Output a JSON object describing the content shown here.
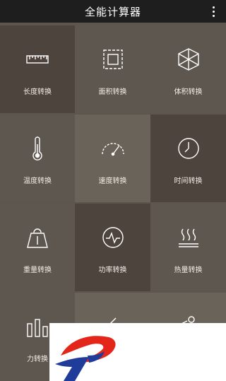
{
  "app": {
    "title": "全能计算器"
  },
  "header": {
    "menu_icon": "more-vert-icon"
  },
  "tiles": [
    {
      "label": "长度转换",
      "icon": "ruler-icon"
    },
    {
      "label": "面积转换",
      "icon": "area-square-icon"
    },
    {
      "label": "体积转换",
      "icon": "cube-icon"
    },
    {
      "label": "温度转换",
      "icon": "thermometer-icon"
    },
    {
      "label": "速度转换",
      "icon": "speedometer-icon"
    },
    {
      "label": "时间转换",
      "icon": "clock-icon"
    },
    {
      "label": "重量转换",
      "icon": "weight-icon"
    },
    {
      "label": "功率转换",
      "icon": "power-meter-icon"
    },
    {
      "label": "热量转换",
      "icon": "heat-icon"
    },
    {
      "label": "力转换",
      "icon": "bar-chart-icon"
    }
  ],
  "ad": {
    "logo": "brand-logo"
  },
  "colors": {
    "topbar": "#1e1e1e",
    "tile_dark": "#4d443d",
    "tile_mid": "#5e574f",
    "tile_light": "#6a635a",
    "logo_red": "#e4261a",
    "logo_blue": "#1f3c9b"
  }
}
